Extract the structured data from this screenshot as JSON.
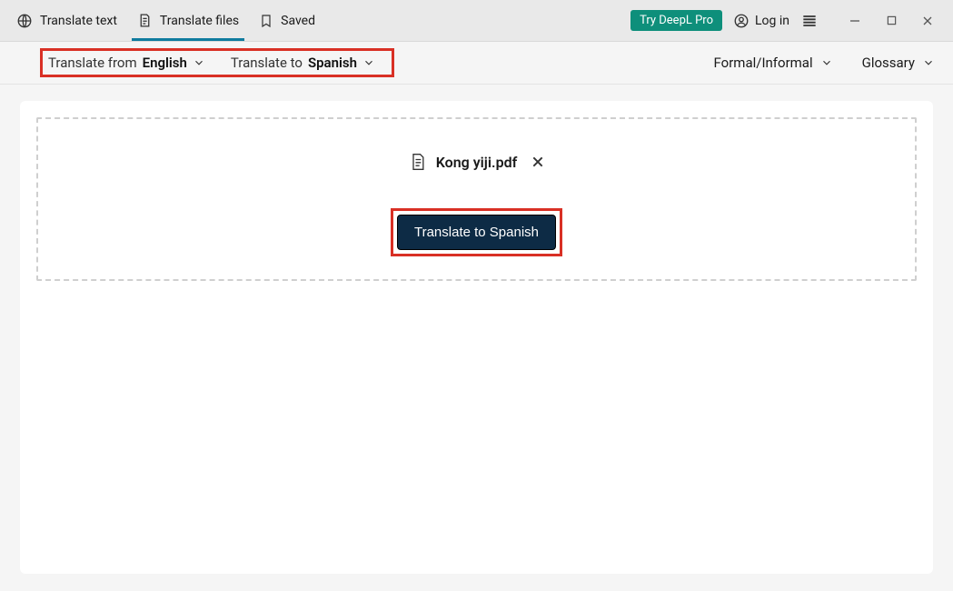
{
  "titlebar": {
    "tabs": {
      "translate_text": "Translate text",
      "translate_files": "Translate files",
      "saved": "Saved"
    },
    "try_pro": "Try DeepL Pro",
    "login": "Log in"
  },
  "subbar": {
    "from_label": "Translate from",
    "from_value": "English",
    "to_label": "Translate to",
    "to_value": "Spanish",
    "formality": "Formal/Informal",
    "glossary": "Glossary"
  },
  "file": {
    "name": "Kong yiji.pdf"
  },
  "actions": {
    "translate_button": "Translate to Spanish"
  }
}
